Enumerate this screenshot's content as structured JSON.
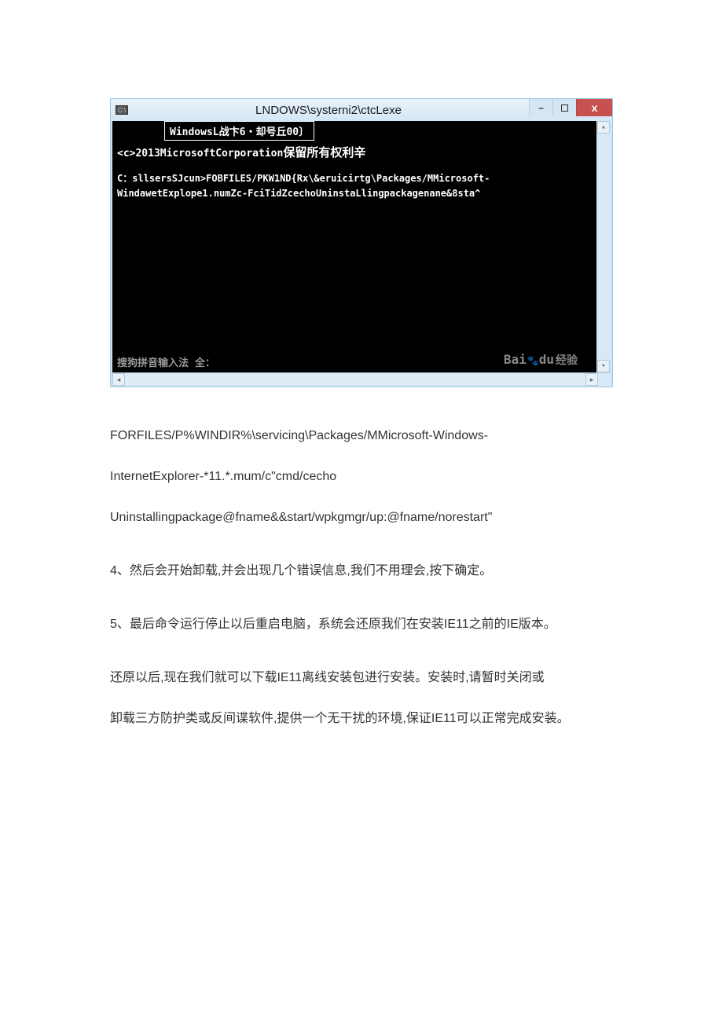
{
  "window": {
    "icon_label": "C:\\",
    "title": "LNDOWS\\systerni2\\ctcLexe",
    "min": "–",
    "close": "x"
  },
  "cmd": {
    "line1": "WindowsL战卞6・却号丘00〕",
    "line2_a": "<c>2013MicrosoftCorporation",
    "line2_b": "保留所有权利辛",
    "line3a": "C：sllsersSJcun>FOBFILES/PKW1ND{Rx\\&eruicirtg\\Packages/MMicrosoft-",
    "line3b": "WindawetExplope1.numZc-FciTidZcechoUninstaLlingpackagenane&8sta^",
    "ime": "搜狗拼音输入法 全：",
    "watermark_en": "Bai",
    "watermark_du": "du",
    "watermark_cn": "经验"
  },
  "body": {
    "p1": "FORFILES/P%WINDIR%\\servicing\\Packages/MMicrosoft-Windows-",
    "p2": "InternetExplorer-*11.*.mum/c\"cmd/cecho",
    "p3": "Uninstallingpackage@fname&&start/wpkgmgr/up:@fname/norestart\"",
    "p4": "4、然后会开始卸载,并会出现几个错误信息,我们不用理会,按下确定。",
    "p5": "5、最后命令运行停止以后重启电脑，系统会还原我们在安装IE11之前的IE版本。",
    "p6": "还原以后,现在我们就可以下载IE11离线安装包进行安装。安装时,请暂时关闭或",
    "p7": "卸载三方防护类或反间谍软件,提供一个无干扰的环境,保证IE11可以正常完成安装。"
  }
}
